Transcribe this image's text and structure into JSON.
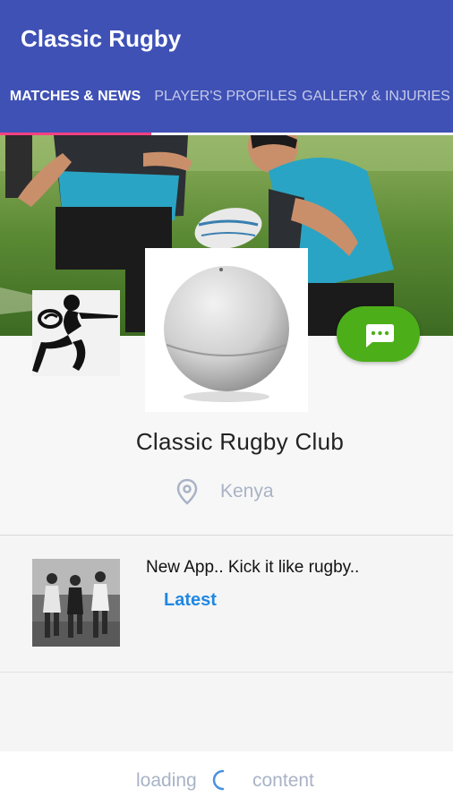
{
  "app": {
    "title": "Classic Rugby"
  },
  "tabs": [
    {
      "label": "MATCHES & NEWS",
      "active": true
    },
    {
      "label": "PLAYER'S PROFILES",
      "active": false
    },
    {
      "label": "GALLERY & INJURIES",
      "active": false
    }
  ],
  "profile": {
    "name": "Classic Rugby Club",
    "location": "Kenya"
  },
  "news": [
    {
      "title": "New App.. Kick it like rugby..",
      "tag": "Latest"
    }
  ],
  "footer": {
    "loading_left": "loading",
    "loading_right": "content"
  },
  "icons": {
    "location": "location-pin-icon",
    "message": "chat-bubble-icon",
    "spinner": "loading-spinner-icon"
  },
  "colors": {
    "appbar": "#3f51b5",
    "indicator": "#ff4081",
    "message_button": "#4caf1a",
    "tag": "#1e88e5",
    "muted_text": "#a9b3c6"
  }
}
